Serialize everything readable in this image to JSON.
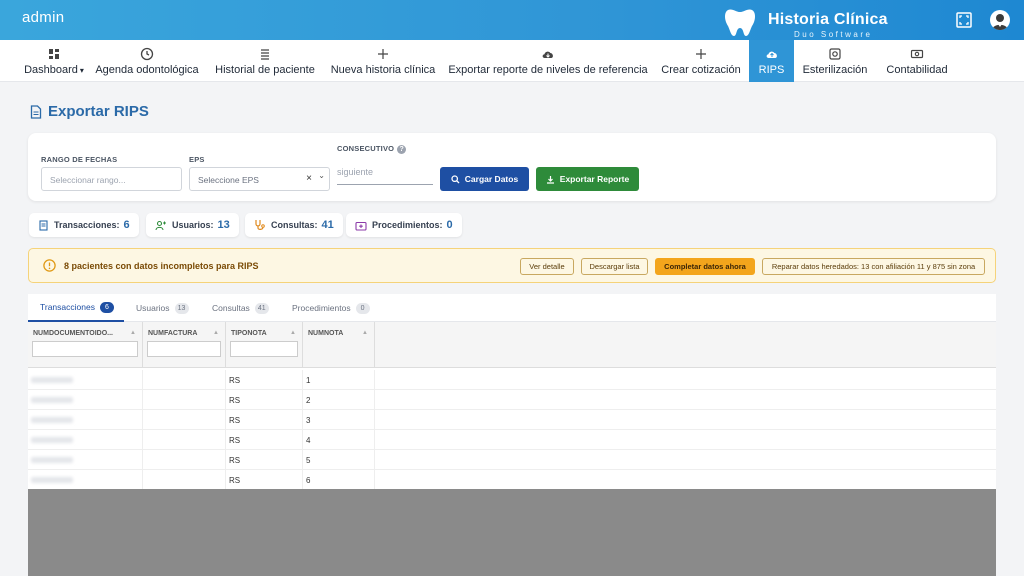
{
  "topbar": {
    "user": "admin",
    "brand": "Historia Clínica",
    "brand_sub": "Duo Software"
  },
  "nav": [
    {
      "label": "Dashboard",
      "icon": "dashboard-icon"
    },
    {
      "label": "Agenda odontológica",
      "icon": "clock-icon"
    },
    {
      "label": "Historial de paciente",
      "icon": "list-icon"
    },
    {
      "label": "Nueva historia clínica",
      "icon": "plus-icon"
    },
    {
      "label": "Exportar reporte de niveles de referencia",
      "icon": "cloud-icon"
    },
    {
      "label": "Crear cotización",
      "icon": "plus-icon"
    },
    {
      "label": "RIPS",
      "icon": "cloud-upload-icon"
    },
    {
      "label": "Esterilización",
      "icon": "sterilize-icon"
    },
    {
      "label": "Contabilidad",
      "icon": "money-icon"
    }
  ],
  "page": {
    "title": "Exportar RIPS"
  },
  "filters": {
    "range_label": "RANGO DE FECHAS",
    "range_placeholder": "Seleccionar rango...",
    "eps_label": "EPS",
    "eps_placeholder": "Seleccione EPS",
    "consec_label": "CONSECUTIVO",
    "consec_placeholder": "siguiente",
    "load_button": "Cargar Datos",
    "export_button": "Exportar Reporte"
  },
  "stats": [
    {
      "label": "Transacciones:",
      "value": "6"
    },
    {
      "label": "Usuarios:",
      "value": "13"
    },
    {
      "label": "Consultas:",
      "value": "41"
    },
    {
      "label": "Procedimientos:",
      "value": "0"
    }
  ],
  "alert": {
    "message": "8 pacientes con datos incompletos para RIPS",
    "btn_detail": "Ver detalle",
    "btn_download": "Descargar lista",
    "btn_complete": "Completar datos ahora",
    "btn_repair": "Reparar datos heredados: 13 con afiliación 11 y 875 sin zona"
  },
  "tabs": [
    {
      "label": "Transacciones",
      "count": "6"
    },
    {
      "label": "Usuarios",
      "count": "13"
    },
    {
      "label": "Consultas",
      "count": "41"
    },
    {
      "label": "Procedimientos",
      "count": "0"
    }
  ],
  "grid": {
    "columns": [
      "NUMDOCUMENTOIDO...",
      "NUMFACTURA",
      "TIPONOTA",
      "NUMNOTA"
    ],
    "rows": [
      {
        "tiponota": "RS",
        "numnota": "1"
      },
      {
        "tiponota": "RS",
        "numnota": "2"
      },
      {
        "tiponota": "RS",
        "numnota": "3"
      },
      {
        "tiponota": "RS",
        "numnota": "4"
      },
      {
        "tiponota": "RS",
        "numnota": "5"
      },
      {
        "tiponota": "RS",
        "numnota": "6"
      }
    ]
  },
  "colors": {
    "primary": "#2f95d6",
    "title": "#2b6aa8",
    "load": "#1e4fa3",
    "export": "#2e8b3a",
    "warning": "#f3a51c"
  }
}
